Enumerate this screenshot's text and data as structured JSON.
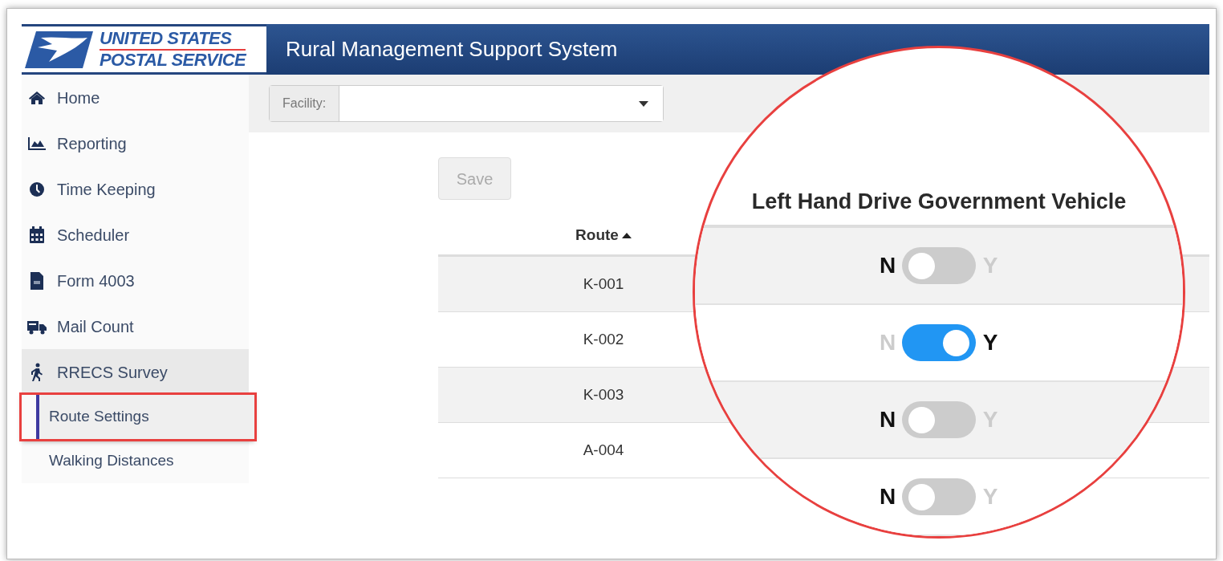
{
  "logo": {
    "line_1": "UNITED STATES",
    "line_2": "POSTAL SERVICE"
  },
  "header": {
    "title": "Rural Management Support System"
  },
  "sidebar": {
    "items": [
      {
        "label": "Home",
        "kind": "home",
        "expanded": false
      },
      {
        "label": "Reporting",
        "kind": "chart",
        "expanded": false
      },
      {
        "label": "Time Keeping",
        "kind": "clock",
        "expanded": false
      },
      {
        "label": "Scheduler",
        "kind": "calendar",
        "expanded": false
      },
      {
        "label": "Form 4003",
        "kind": "file",
        "expanded": false
      },
      {
        "label": "Mail Count",
        "kind": "truck",
        "expanded": false
      },
      {
        "label": "RRECS Survey",
        "kind": "walker",
        "expanded": true,
        "children": [
          {
            "label": "Route Settings",
            "selected": true,
            "highlighted": true
          },
          {
            "label": "Walking Distances",
            "selected": false,
            "highlighted": false
          }
        ]
      }
    ]
  },
  "facility": {
    "label": "Facility:"
  },
  "save_button": {
    "label": "Save",
    "disabled": true
  },
  "table": {
    "columns": [
      {
        "label": "Route",
        "sort_ascending": true
      }
    ],
    "rows": [
      {
        "route": "K-001"
      },
      {
        "route": "K-002"
      },
      {
        "route": "K-003"
      },
      {
        "route": "A-004"
      }
    ]
  },
  "callout": {
    "heading": "Left Hand Drive Government Vehicle",
    "rows": [
      {
        "off_label": "N",
        "on_label": "Y",
        "on": false
      },
      {
        "off_label": "N",
        "on_label": "Y",
        "on": true
      },
      {
        "off_label": "N",
        "on_label": "Y",
        "on": false
      },
      {
        "off_label": "N",
        "on_label": "Y",
        "on": false
      }
    ]
  }
}
